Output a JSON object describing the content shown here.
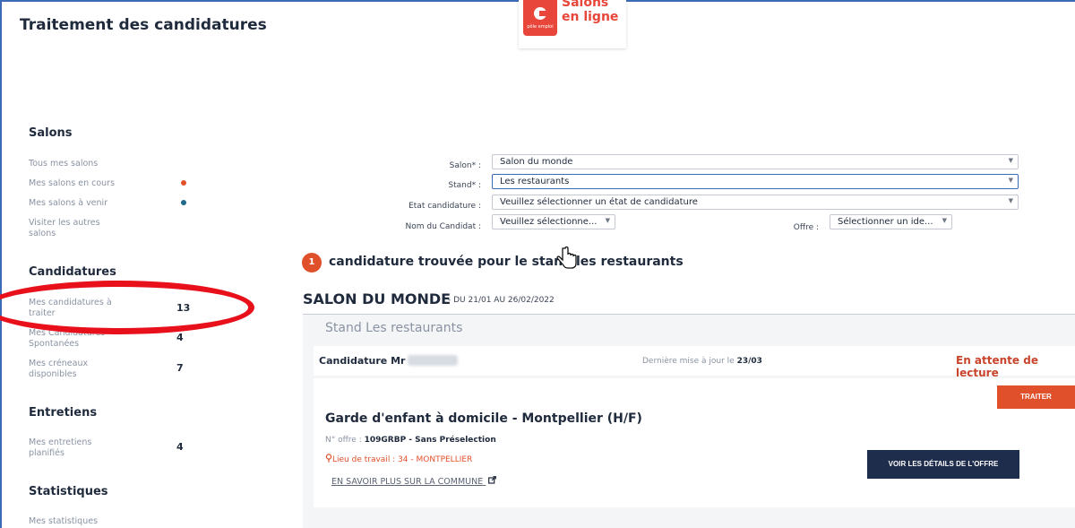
{
  "header": {
    "title": "Traitement des candidatures"
  },
  "logo": {
    "line1": "Salons",
    "line2": "en ligne",
    "badge": "pôle emploi"
  },
  "sidebar": {
    "salons_heading": "Salons",
    "salons": [
      {
        "label": "Tous mes salons"
      },
      {
        "label": "Mes salons en cours",
        "dot_color": "#e0502b"
      },
      {
        "label": "Mes salons à venir",
        "dot_color": "#1f6a8a"
      },
      {
        "label": "Visiter les autres salons"
      }
    ],
    "candidatures_heading": "Candidatures",
    "candidatures": [
      {
        "label": "Mes candidatures à traiter",
        "count": "13"
      },
      {
        "label": "Mes Candidatures Spontanées",
        "count": "4"
      },
      {
        "label": "Mes créneaux disponibles",
        "count": "7"
      }
    ],
    "entretiens_heading": "Entretiens",
    "entretiens": [
      {
        "label": "Mes entretiens planifiés",
        "count": "4"
      }
    ],
    "stats_heading": "Statistiques",
    "stats": [
      {
        "label": "Mes statistiques"
      }
    ]
  },
  "filters": {
    "salon_label": "Salon* :",
    "salon_value": "Salon du monde",
    "stand_label": "Stand* :",
    "stand_value": "Les restaurants",
    "etat_label": "Etat candidature :",
    "etat_value": "Veuillez sélectionner un état de candidature",
    "nom_label": "Nom du Candidat :",
    "nom_value": "Veuillez sélectionne...",
    "offre_label": "Offre :",
    "offre_value": "Sélectionner un ide..."
  },
  "results": {
    "count": "1",
    "text": "candidature trouvée pour le stand les restaurants"
  },
  "salon": {
    "name": "SALON DU MONDE",
    "dates": "- DU 21/01 AU 26/02/2022",
    "stand": "Stand Les restaurants"
  },
  "candidature": {
    "name": "Candidature Mr",
    "updated_label": "Dernière mise à jour le",
    "updated_date": "23/03",
    "status": "En attente de lecture",
    "status_color": "#c8442b",
    "treat_label": "TRAITER"
  },
  "offer": {
    "title": "Garde d'enfant à domicile - Montpellier (H/F)",
    "number_label": "N° offre :",
    "number_value": "109GRBP - Sans Préselection",
    "location": "Lieu de travail : 34 - MONTPELLIER",
    "commune_link": "EN SAVOIR PLUS SUR LA COMMUNE",
    "details_button": "VOIR LES DÉTAILS DE L'OFFRE"
  }
}
